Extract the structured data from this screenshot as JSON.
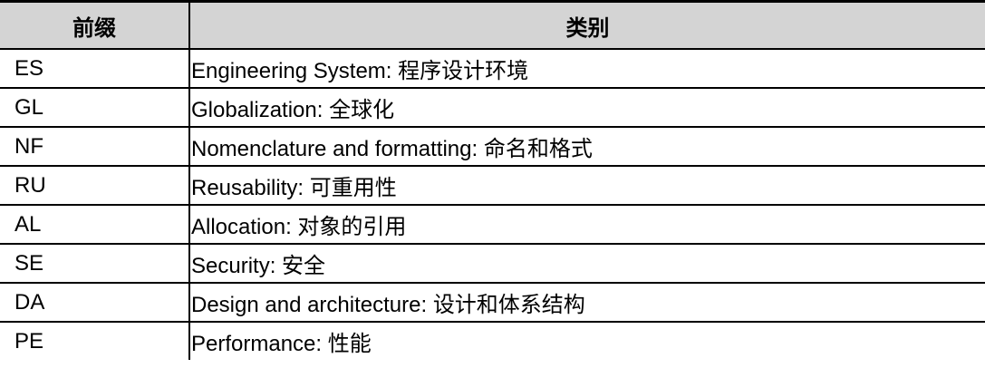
{
  "table": {
    "headers": {
      "prefix": "前缀",
      "category": "类别"
    },
    "rows": [
      {
        "code": "ES",
        "category": "Engineering System: 程序设计环境"
      },
      {
        "code": "GL",
        "category": "Globalization:  全球化"
      },
      {
        "code": "NF",
        "category": "Nomenclature and formatting: 命名和格式"
      },
      {
        "code": "RU",
        "category": "Reusability: 可重用性"
      },
      {
        "code": "AL",
        "category": "Allocation: 对象的引用"
      },
      {
        "code": "SE",
        "category": "Security: 安全"
      },
      {
        "code": "DA",
        "category": "Design and architecture: 设计和体系结构"
      },
      {
        "code": "PE",
        "category": "Performance: 性能"
      }
    ]
  }
}
